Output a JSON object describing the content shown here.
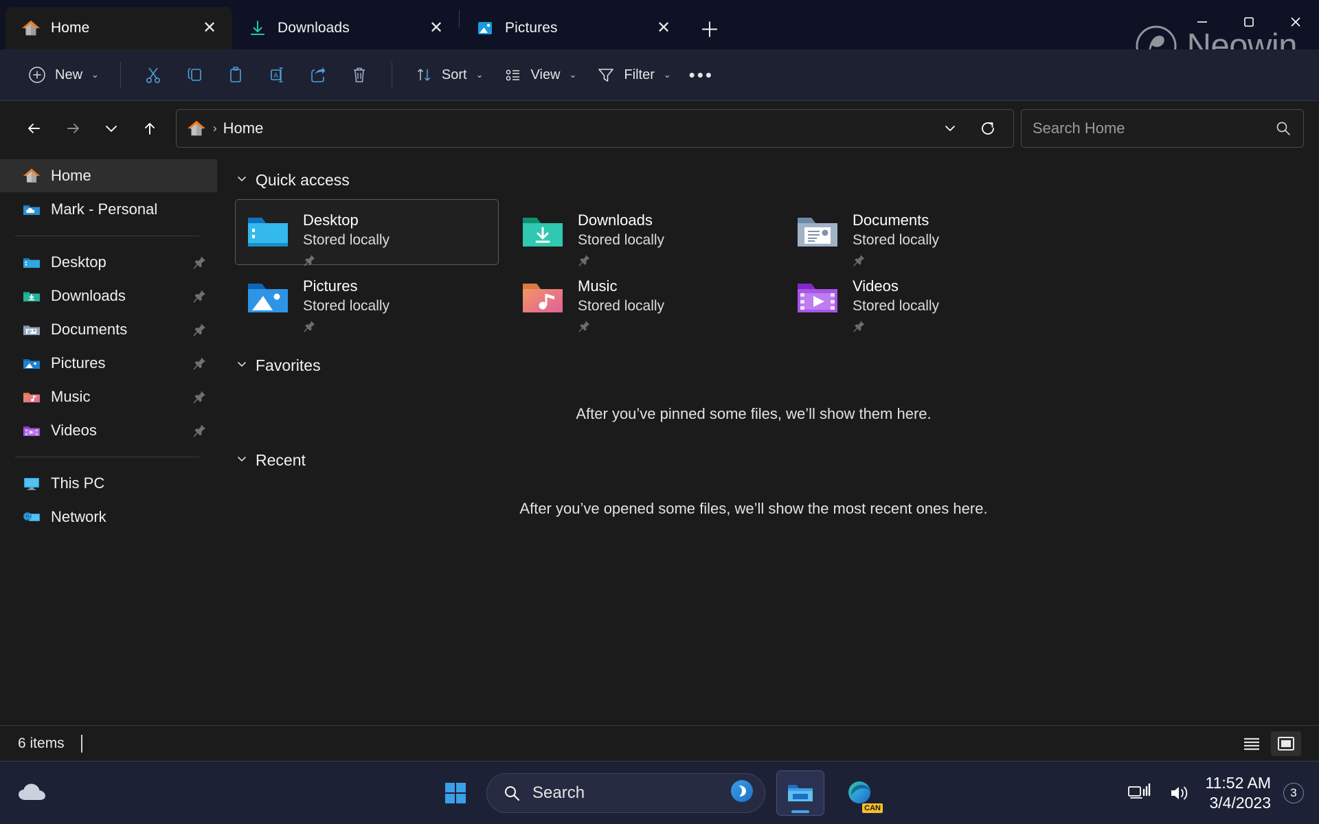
{
  "window": {
    "tabs": [
      {
        "label": "Home",
        "icon": "home-icon",
        "active": true,
        "close_label": "✕"
      },
      {
        "label": "Downloads",
        "icon": "downloads-icon",
        "active": false,
        "close_label": "✕"
      },
      {
        "label": "Pictures",
        "icon": "pictures-icon",
        "active": false,
        "close_label": "✕"
      }
    ],
    "new_tab_label": "＋",
    "caption": {
      "minimize": "─",
      "maximize": "☐",
      "close": "✕"
    },
    "watermark": "Neowin"
  },
  "toolbar": {
    "new_label": "New",
    "cut_label": "Cut",
    "copy_label": "Copy",
    "paste_label": "Paste",
    "rename_label": "Rename",
    "share_label": "Share",
    "delete_label": "Delete",
    "sort_label": "Sort",
    "view_label": "View",
    "filter_label": "Filter",
    "more_label": "•••",
    "chevron": "⌄"
  },
  "address": {
    "back_label": "Back",
    "forward_label": "Forward",
    "recent_label": "Recent locations",
    "up_label": "Up",
    "breadcrumb_icon": "home-icon",
    "breadcrumb_separator": "›",
    "breadcrumb_text": "Home",
    "dropdown_label": "⌄",
    "refresh_label": "Refresh"
  },
  "search": {
    "placeholder": "Search Home",
    "icon": "search-icon"
  },
  "sidebar": {
    "groups": [
      {
        "items": [
          {
            "label": "Home",
            "icon": "home-icon",
            "selected": true,
            "pinned": false
          },
          {
            "label": "Mark - Personal",
            "icon": "onedrive-folder-icon",
            "selected": false,
            "pinned": false
          }
        ]
      },
      {
        "items": [
          {
            "label": "Desktop",
            "icon": "desktop-folder-icon",
            "selected": false,
            "pinned": true
          },
          {
            "label": "Downloads",
            "icon": "downloads-folder-icon",
            "selected": false,
            "pinned": true
          },
          {
            "label": "Documents",
            "icon": "documents-folder-icon",
            "selected": false,
            "pinned": true
          },
          {
            "label": "Pictures",
            "icon": "pictures-folder-icon",
            "selected": false,
            "pinned": true
          },
          {
            "label": "Music",
            "icon": "music-folder-icon",
            "selected": false,
            "pinned": true
          },
          {
            "label": "Videos",
            "icon": "videos-folder-icon",
            "selected": false,
            "pinned": true
          }
        ]
      },
      {
        "items": [
          {
            "label": "This PC",
            "icon": "this-pc-icon",
            "selected": false,
            "pinned": false
          },
          {
            "label": "Network",
            "icon": "network-icon",
            "selected": false,
            "pinned": false
          }
        ]
      }
    ]
  },
  "content": {
    "quick_access": {
      "title": "Quick access",
      "chevron": "⌄",
      "tiles": [
        {
          "name": "Desktop",
          "sub": "Stored locally",
          "icon": "desktop-folder-icon",
          "selected": true,
          "pinned": true
        },
        {
          "name": "Downloads",
          "sub": "Stored locally",
          "icon": "downloads-folder-icon",
          "selected": false,
          "pinned": true
        },
        {
          "name": "Documents",
          "sub": "Stored locally",
          "icon": "documents-folder-icon",
          "selected": false,
          "pinned": true
        },
        {
          "name": "Pictures",
          "sub": "Stored locally",
          "icon": "pictures-folder-icon",
          "selected": false,
          "pinned": true
        },
        {
          "name": "Music",
          "sub": "Stored locally",
          "icon": "music-folder-icon",
          "selected": false,
          "pinned": true
        },
        {
          "name": "Videos",
          "sub": "Stored locally",
          "icon": "videos-folder-icon",
          "selected": false,
          "pinned": true
        }
      ]
    },
    "favorites": {
      "title": "Favorites",
      "chevron": "⌄",
      "empty_message": "After you’ve pinned some files, we’ll show them here."
    },
    "recent": {
      "title": "Recent",
      "chevron": "⌄",
      "empty_message": "After you’ve opened some files, we’ll show the most recent ones here."
    }
  },
  "statusbar": {
    "item_count": "6 items",
    "details_view_label": "Details view",
    "large_icons_view_label": "Large icons view"
  },
  "taskbar": {
    "start_label": "Start",
    "search_placeholder": "Search",
    "copilot_label": "Copilot",
    "explorer_label": "File Explorer",
    "edge_label": "Microsoft Edge",
    "edge_badge": "CAN",
    "network_label": "Network",
    "volume_label": "Volume",
    "time": "11:52 AM",
    "date": "3/4/2023",
    "notification_count": "3"
  },
  "colors": {
    "accent": "#4aa3e8",
    "titlebar_bg": "#0e1224",
    "commandbar_bg": "#1e2132",
    "window_bg": "#1b1b1b",
    "taskbar_bg": "#1d2136",
    "home_orange": "#f07818"
  }
}
